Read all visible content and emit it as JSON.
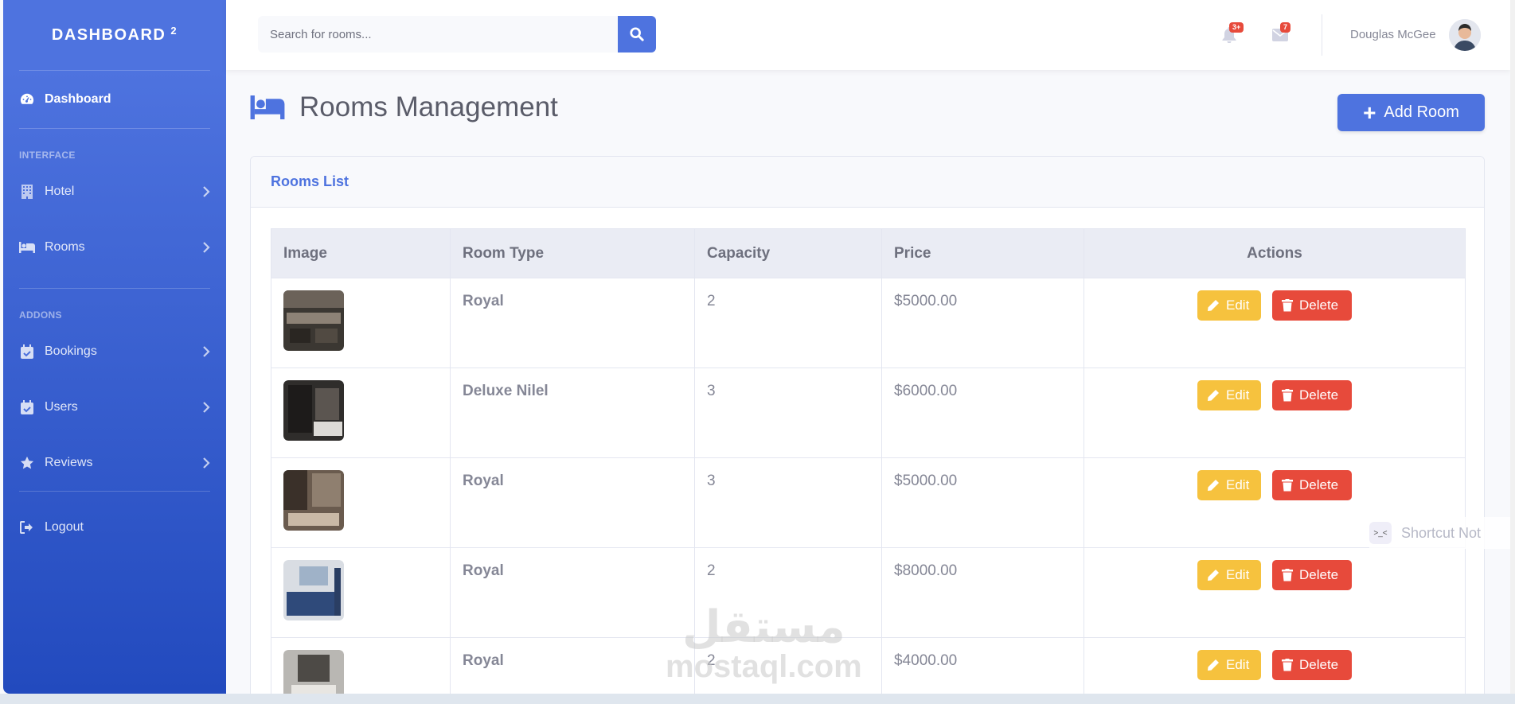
{
  "sidebar": {
    "brand": "DASHBOARD",
    "brand_sup": "2",
    "dashboard_label": "Dashboard",
    "heading_interface": "INTERFACE",
    "heading_addons": "ADDONS",
    "items": [
      {
        "label": "Hotel"
      },
      {
        "label": "Rooms"
      },
      {
        "label": "Bookings"
      },
      {
        "label": "Users"
      },
      {
        "label": "Reviews"
      }
    ],
    "logout_label": "Logout"
  },
  "topbar": {
    "search_placeholder": "Search for rooms...",
    "alerts_badge": "3+",
    "messages_badge": "7",
    "user_name": "Douglas McGee"
  },
  "page": {
    "title": "Rooms Management",
    "add_button": "Add Room"
  },
  "card": {
    "title": "Rooms List"
  },
  "table": {
    "headers": [
      "Image",
      "Room Type",
      "Capacity",
      "Price",
      "Actions"
    ],
    "edit_label": "Edit",
    "delete_label": "Delete",
    "rows": [
      {
        "type": "Royal",
        "capacity": "2",
        "price": "$5000.00"
      },
      {
        "type": "Deluxe Nilel",
        "capacity": "3",
        "price": "$6000.00"
      },
      {
        "type": "Royal",
        "capacity": "3",
        "price": "$5000.00"
      },
      {
        "type": "Royal",
        "capacity": "2",
        "price": "$8000.00"
      },
      {
        "type": "Royal",
        "capacity": "2",
        "price": "$4000.00"
      }
    ]
  },
  "overlay": {
    "shortcut_text": "Shortcut Not",
    "watermark_ar": "مستقل",
    "watermark_en": "mostaql.com"
  },
  "colors": {
    "primary": "#4e73df",
    "warning": "#f6c23e",
    "danger": "#e74a3b"
  }
}
